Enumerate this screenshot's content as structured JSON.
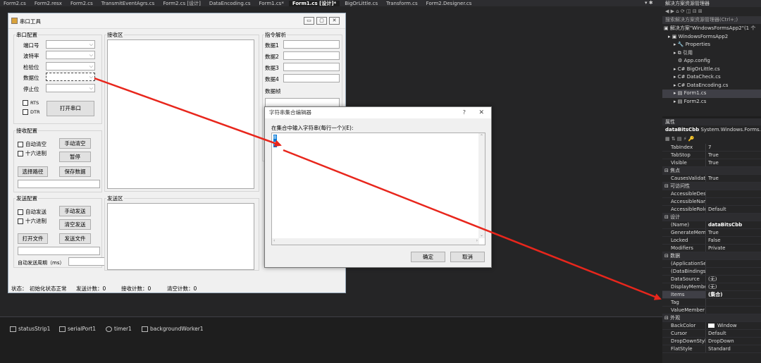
{
  "editor_tabs": [
    "Form2.cs",
    "Form2.resx",
    "Form2.cs",
    "TransmitEventAgrs.cs",
    "Form2.cs [设计]",
    "DataEncoding.cs",
    "Form1.cs*",
    "Form1.cs [设计]*",
    "BigOrLittle.cs",
    "Transform.cs",
    "Form2.Designer.cs"
  ],
  "active_tab_index": 7,
  "form": {
    "title": "串口工具",
    "serial_group": {
      "title": "串口配置",
      "port_label": "端口号",
      "baud_label": "波特率",
      "parity_label": "检验位",
      "databits_label": "数据位",
      "stopbits_label": "停止位",
      "rts_label": "RTS",
      "dtr_label": "DTR",
      "open_button": "打开串口"
    },
    "receive_group": {
      "title": "接收配置",
      "auto_clear": "自动清空",
      "hex": "十六进制",
      "manual_clear": "手动清空",
      "pause": "暂停",
      "choose_path": "选择路径",
      "save_data": "保存数据"
    },
    "send_group": {
      "title": "发送配置",
      "auto_send": "自动发送",
      "hex": "十六进制",
      "manual_send": "手动发送",
      "clear_send": "清空发送",
      "open_file": "打开文件",
      "send_file": "发送文件",
      "period_label": "自动发送周期（ms）"
    },
    "receive_area": "接收区",
    "send_area": "发送区",
    "command_group": {
      "title": "指令解析",
      "data1": "数据1",
      "data2": "数据2",
      "data3": "数据3",
      "data4": "数据4",
      "data_check": "数据帧"
    },
    "status": {
      "label": "状态：",
      "state": "初始化状态正常",
      "send_count": "发送计数：0",
      "recv_count": "接收计数：0",
      "clear_count": "清空计数：0"
    }
  },
  "dialog": {
    "title": "字符串集合编辑器",
    "help": "?",
    "close": "✕",
    "prompt": "在集合中输入字符串(每行一个)(E):",
    "lines": [
      "8",
      "7"
    ],
    "ok": "确定",
    "cancel": "取消"
  },
  "tray": [
    "statusStrip1",
    "serialPort1",
    "timer1",
    "backgroundWorker1"
  ],
  "solution_explorer": {
    "title": "解决方案资源管理器",
    "search_placeholder": "搜索解决方案资源管理器(Ctrl+;)",
    "nodes": [
      "解决方案\"WindowsFormsApp2\"(1 个",
      "WindowsFormsApp2",
      "Properties",
      "引用",
      "App.config",
      "BigOrLittle.cs",
      "DataCheck.cs",
      "DataEncoding.cs",
      "Form1.cs",
      "Form2.cs"
    ]
  },
  "properties": {
    "title": "属性",
    "object_name": "dataBitsCbb",
    "object_type": "System.Windows.Forms.Co",
    "rows": [
      {
        "name": "TabIndex",
        "value": "7",
        "cat": false
      },
      {
        "name": "TabStop",
        "value": "True",
        "cat": false
      },
      {
        "name": "Visible",
        "value": "True",
        "cat": false
      },
      {
        "name": "焦点",
        "value": "",
        "cat": true
      },
      {
        "name": "CausesValidation",
        "value": "True",
        "cat": false
      },
      {
        "name": "可访问性",
        "value": "",
        "cat": true
      },
      {
        "name": "AccessibleDescrip",
        "value": "",
        "cat": false
      },
      {
        "name": "AccessibleName",
        "value": "",
        "cat": false
      },
      {
        "name": "AccessibleRole",
        "value": "Default",
        "cat": false
      },
      {
        "name": "设计",
        "value": "",
        "cat": true
      },
      {
        "name": "(Name)",
        "value": "dataBitsCbb",
        "cat": false
      },
      {
        "name": "GenerateMember",
        "value": "True",
        "cat": false
      },
      {
        "name": "Locked",
        "value": "False",
        "cat": false
      },
      {
        "name": "Modifiers",
        "value": "Private",
        "cat": false
      },
      {
        "name": "数据",
        "value": "",
        "cat": true
      },
      {
        "name": "(ApplicationSettin",
        "value": "",
        "cat": false
      },
      {
        "name": "(DataBindings)",
        "value": "",
        "cat": false
      },
      {
        "name": "DataSource",
        "value": "(无)",
        "cat": false
      },
      {
        "name": "DisplayMember",
        "value": "(无)",
        "cat": false
      },
      {
        "name": "Items",
        "value": "(集合)",
        "cat": false
      },
      {
        "name": "Tag",
        "value": "",
        "cat": false
      },
      {
        "name": "ValueMember",
        "value": "",
        "cat": false
      },
      {
        "name": "外观",
        "value": "",
        "cat": true
      },
      {
        "name": "BackColor",
        "value": "Window",
        "cat": false
      },
      {
        "name": "Cursor",
        "value": "Default",
        "cat": false
      },
      {
        "name": "DropDownStyle",
        "value": "DropDown",
        "cat": false
      },
      {
        "name": "FlatStyle",
        "value": "Standard",
        "cat": false
      }
    ]
  },
  "colors": {
    "arrow": "#e8261c",
    "vs_dark": "#1e1e1e",
    "form_bg": "#f0f0f0"
  }
}
